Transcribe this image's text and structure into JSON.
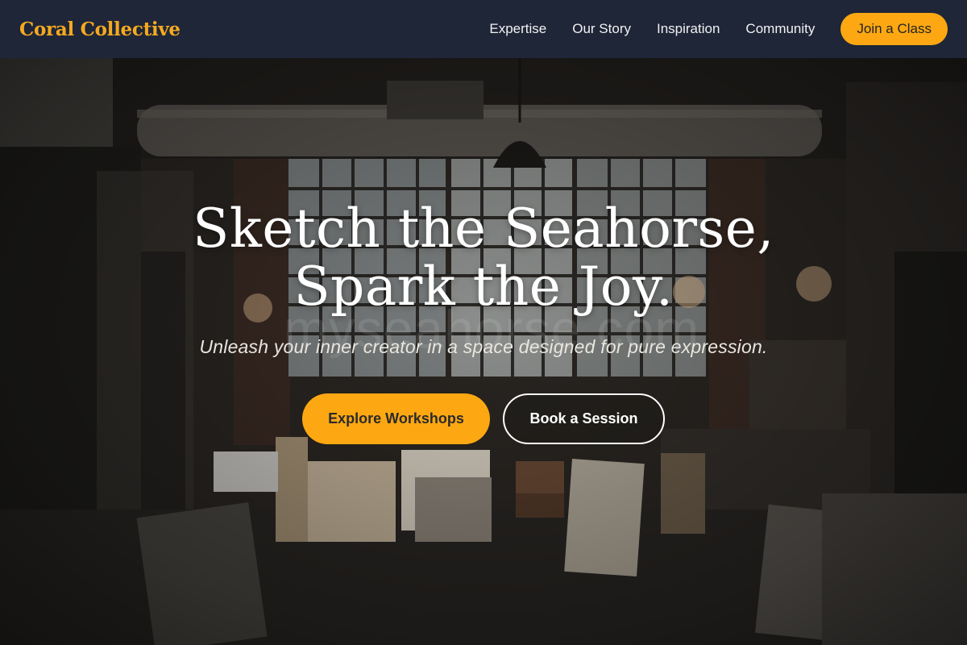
{
  "nav": {
    "brand": "Coral Collective",
    "links": [
      "Expertise",
      "Our Story",
      "Inspiration",
      "Community"
    ],
    "cta_label": "Join a Class"
  },
  "hero": {
    "headline_line1": "Sketch the Seahorse,",
    "headline_line2": "Spark the Joy.",
    "watermark": "myseahorse.com",
    "subheadline": "Unleash your inner creator in a space designed for pure expression.",
    "primary_button": "Explore Workshops",
    "secondary_button": "Book a Session"
  },
  "colors": {
    "nav_background": "#1e2638",
    "brand": "#f6a920",
    "accent": "#fda812"
  }
}
